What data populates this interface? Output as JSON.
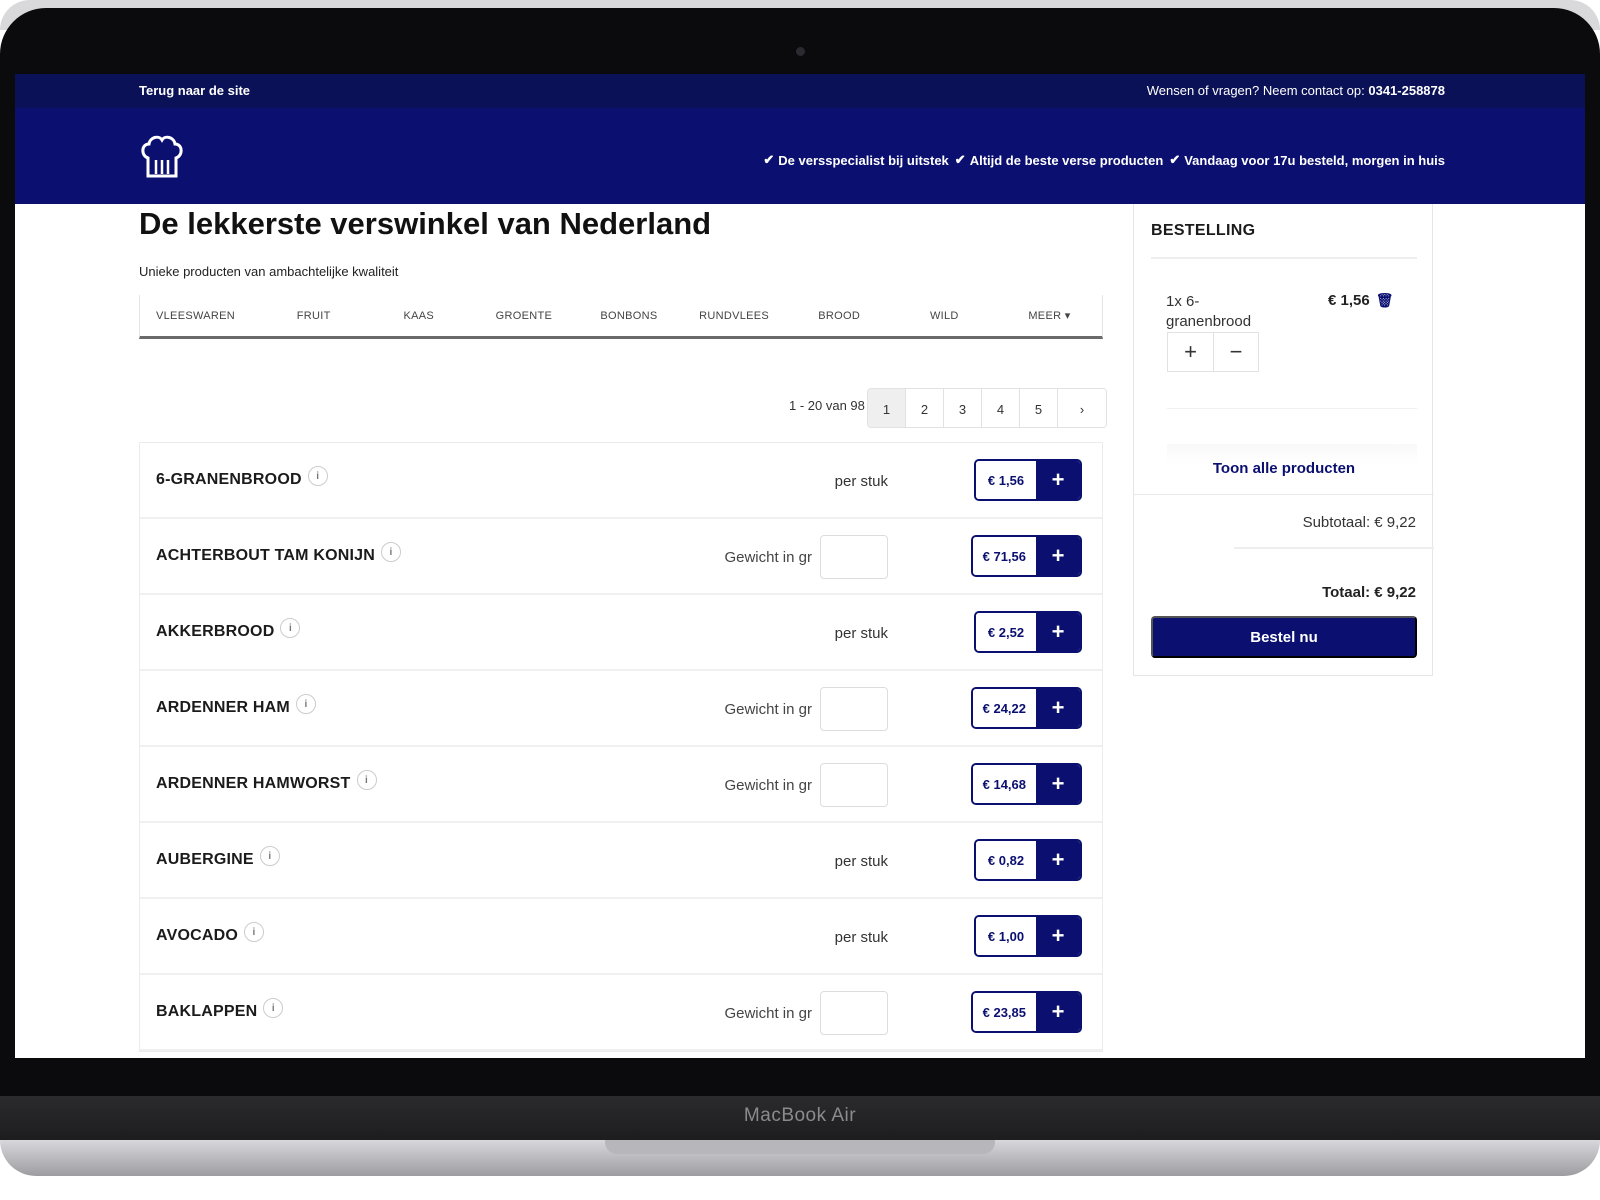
{
  "device": {
    "model_label": "MacBook Air"
  },
  "topbar": {
    "back_link": "Terug naar de site",
    "contact_prefix": "Wensen of vragen? Neem contact op:",
    "contact_phone": "0341-258878"
  },
  "header": {
    "usps": [
      "De versspecialist bij uitstek",
      "Altijd de beste verse producten",
      "Vandaag voor 17u besteld, morgen in huis"
    ]
  },
  "main": {
    "title": "De lekkerste verswinkel van Nederland",
    "subtitle": "Unieke producten van ambachtelijke kwaliteit",
    "categories": [
      "VLEESWAREN",
      "FRUIT",
      "KAAS",
      "GROENTE",
      "BONBONS",
      "RUNDVLEES",
      "BROOD",
      "WILD",
      "MEER"
    ],
    "more_caret": "▾",
    "pagination": {
      "info": "1 - 20 van 98",
      "pages": [
        "1",
        "2",
        "3",
        "4",
        "5"
      ],
      "next": "›",
      "active": "1"
    },
    "weight_label": "Gewicht in gr",
    "unit_label": "per stuk",
    "products": [
      {
        "name": "6-GRANENBROOD",
        "type": "unit",
        "price": "€ 1,56"
      },
      {
        "name": "ACHTERBOUT TAM KONIJN",
        "type": "weight",
        "price": "€ 71,56"
      },
      {
        "name": "AKKERBROOD",
        "type": "unit",
        "price": "€ 2,52"
      },
      {
        "name": "ARDENNER HAM",
        "type": "weight",
        "price": "€ 24,22"
      },
      {
        "name": "ARDENNER HAMWORST",
        "type": "weight",
        "price": "€ 14,68"
      },
      {
        "name": "AUBERGINE",
        "type": "unit",
        "price": "€ 0,82"
      },
      {
        "name": "AVOCADO",
        "type": "unit",
        "price": "€ 1,00"
      },
      {
        "name": "BAKLAPPEN",
        "type": "weight",
        "price": "€ 23,85"
      }
    ]
  },
  "order": {
    "title": "BESTELLING",
    "item": {
      "name": "1x 6-granenbrood",
      "price": "€ 1,56"
    },
    "show_all": "Toon alle producten",
    "subtotal": "Subtotaal: € 9,22",
    "total": "Totaal: € 9,22",
    "button": "Bestel nu"
  },
  "colors": {
    "navy_dark": "#0a1156",
    "navy": "#0a0f70"
  }
}
